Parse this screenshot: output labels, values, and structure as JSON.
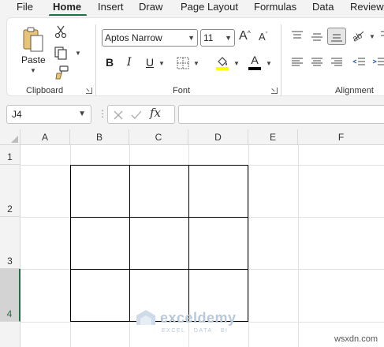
{
  "menu": {
    "tabs": [
      "File",
      "Home",
      "Insert",
      "Draw",
      "Page Layout",
      "Formulas",
      "Data",
      "Review"
    ],
    "active": "Home"
  },
  "ribbon": {
    "clipboard": {
      "paste_label": "Paste",
      "group_label": "Clipboard"
    },
    "font": {
      "font_name": "Aptos Narrow",
      "font_size": "11",
      "group_label": "Font",
      "fill_color": "#ffff00",
      "font_color": "#000000"
    },
    "alignment": {
      "group_label": "Alignment"
    }
  },
  "formula_bar": {
    "name_box": "J4",
    "fx_label": "fx",
    "formula": ""
  },
  "sheet": {
    "columns": [
      "A",
      "B",
      "C",
      "D",
      "E",
      "F"
    ],
    "rows": [
      "1",
      "2",
      "3",
      "4"
    ],
    "selected_cell": "J4",
    "selected_row": "4",
    "bordered_range": "B2:D4"
  },
  "watermark": {
    "name": "exceldemy",
    "tagline": "EXCEL · DATA · BI"
  },
  "site_watermark": "wsxdn.com",
  "colors": {
    "accent": "#1e7145",
    "ribbon_bg": "#f3f3f3",
    "grid_line": "#e1e1e1"
  }
}
